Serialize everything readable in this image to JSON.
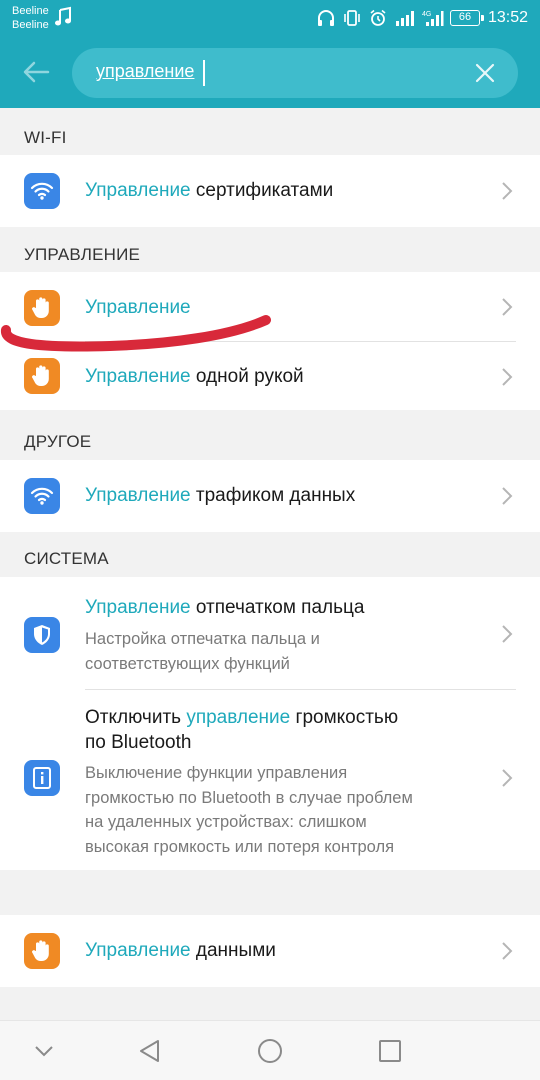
{
  "status_bar": {
    "carrier1": "Beeline",
    "carrier2": "Beeline",
    "battery": "66",
    "time": "13:52"
  },
  "search": {
    "query": "управление"
  },
  "sections": {
    "wifi": "WI-FI",
    "control": "УПРАВЛЕНИЕ",
    "other": "ДРУГОЕ",
    "system": "СИСТЕМА"
  },
  "rows": {
    "certs": {
      "hl": "Управление",
      "rest": " сертификатами"
    },
    "control": {
      "hl": "Управление",
      "rest": ""
    },
    "onehand": {
      "hl": "Управление",
      "rest": " одной рукой"
    },
    "traffic": {
      "hl": "Управление",
      "rest": " трафиком данных"
    },
    "fingerprint": {
      "hl": "Управление",
      "rest": " отпечатком пальца",
      "sub1": "Настройка отпечатка пальца и",
      "sub2": "соответствующих функций"
    },
    "bt_volume": {
      "pre": "Отключить ",
      "hl": "управление",
      "rest": " громкостью",
      "line2": "по Bluetooth",
      "sub1": "Выключение функции управления",
      "sub2": "громкостью по Bluetooth в случае проблем",
      "sub3": "на удаленных устройствах: слишком",
      "sub4": "высокая громкость или потеря контроля"
    },
    "data": {
      "hl": "Управление",
      "rest": " данными"
    }
  },
  "colors": {
    "accent": "#1fa9bb",
    "icon_blue": "#3a86e6",
    "icon_orange": "#f08a24",
    "marker_red": "#d8293a"
  },
  "icons": {
    "back": "arrow-left-icon",
    "clear": "close-icon",
    "wifi": "wifi-icon",
    "hand": "hand-icon",
    "shield": "shield-icon",
    "info": "info-icon",
    "chevron": "chevron-right-icon",
    "nav": [
      "chevron-down-icon",
      "back-triangle-icon",
      "home-circle-icon",
      "recents-square-icon"
    ]
  }
}
